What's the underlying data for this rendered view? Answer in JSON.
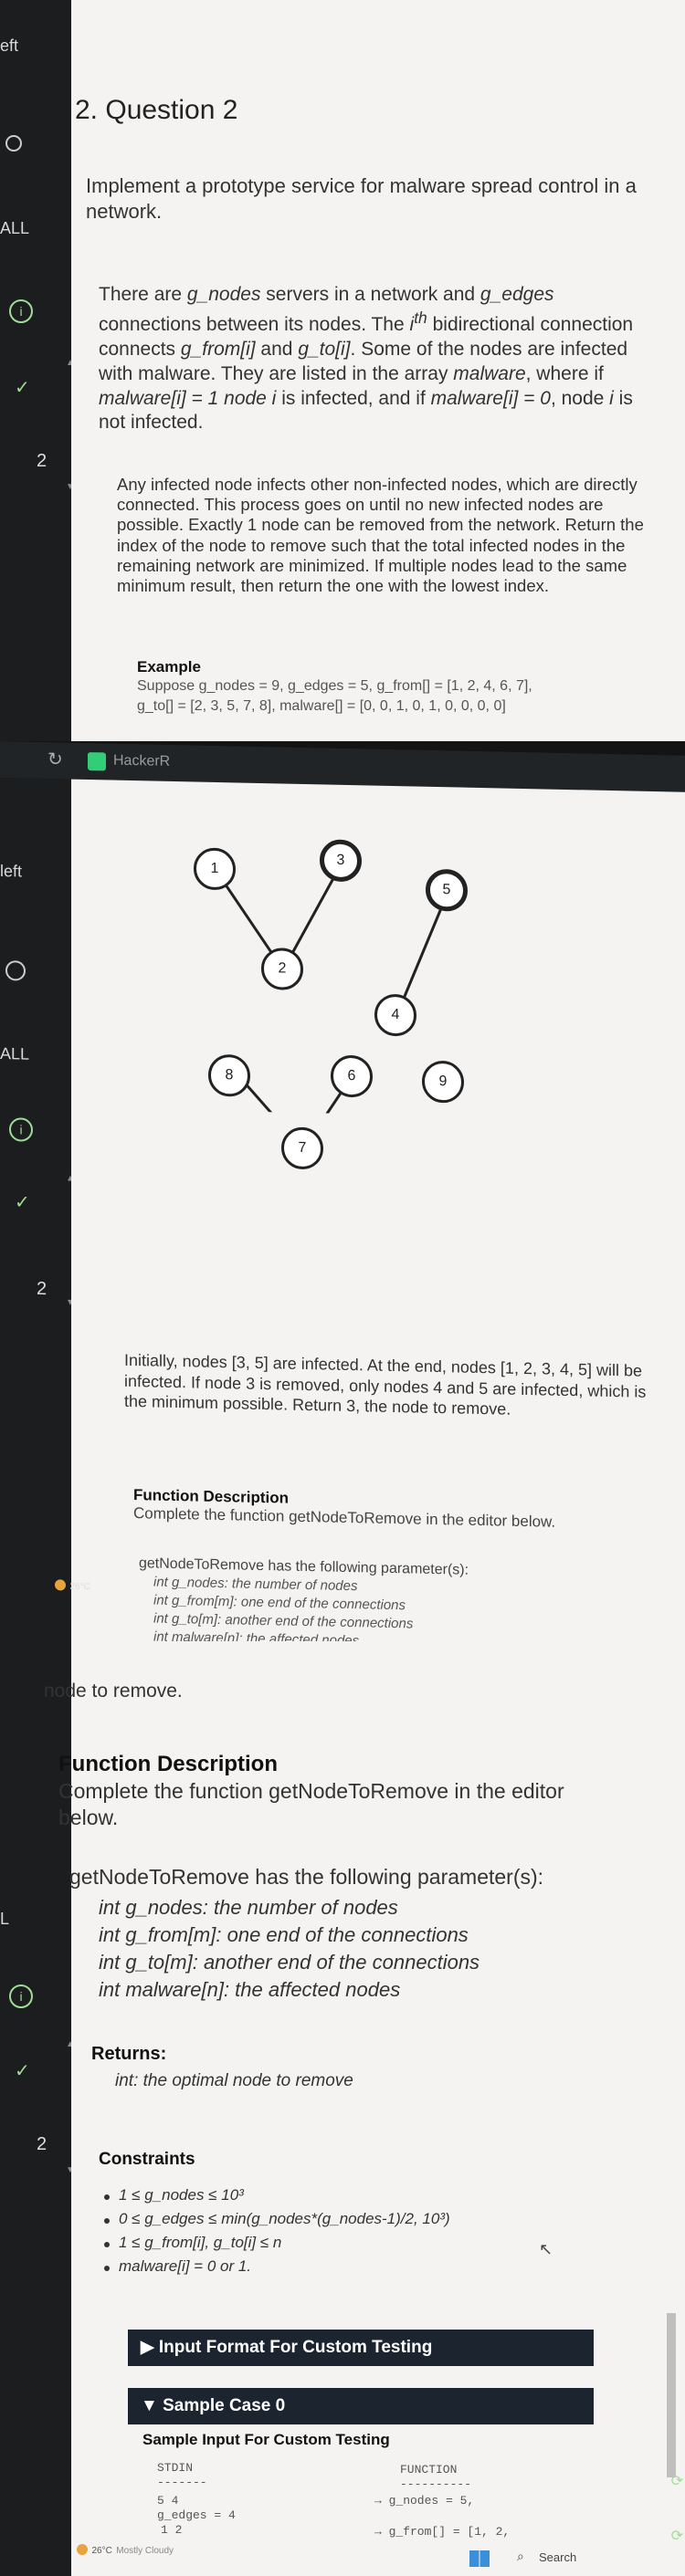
{
  "rail": {
    "label_left": "eft",
    "label_all": "ALL",
    "item_number": "2",
    "label_left2": "left",
    "label_all2": "ALL",
    "label_L": "L"
  },
  "question": {
    "title": "2. Question 2",
    "intro": "Implement a prototype service for malware spread control in a network.",
    "para1_a": "There are ",
    "para1_gnodes": "g_nodes",
    "para1_b": " servers in a network and ",
    "para1_gedges": "g_edges",
    "para1_c": " connections between its nodes. The ",
    "para1_ith": "i",
    "para1_th": "th",
    "para1_d": " bidirectional connection connects ",
    "para1_from": "g_from[i]",
    "para1_e": " and ",
    "para1_to": "g_to[i]",
    "para1_f": ". Some of the nodes are infected with malware. They are listed in the array ",
    "para1_malware": "malware",
    "para1_g": ", where if ",
    "para1_m1": "malware[i] = 1 node i",
    "para1_h": " is infected, and if ",
    "para1_m0": "malware[i] = 0",
    "para1_i": ", node ",
    "para1_ii": "i",
    "para1_j": " is not infected.",
    "para2": "Any infected node infects other non-infected nodes, which are directly connected. This process goes on until no new infected nodes are possible. Exactly 1 node can be removed from the network. Return the index of the node to remove such that the total infected nodes in the remaining network are minimized. If multiple nodes lead to the same minimum result, then return the one with the lowest index.",
    "example_heading": "Example",
    "example_line1": "Suppose g_nodes = 9, g_edges = 5, g_from[] = [1, 2, 4, 6, 7],",
    "example_line2": "g_to[] = [2, 3, 5, 7, 8], malware[] = [0, 0, 1, 0, 1, 0, 0, 0, 0]",
    "explanation": "Initially, nodes [3, 5] are infected. At the end, nodes [1, 2, 3, 4, 5] will be infected. If node 3 is removed, only nodes 4 and 5 are infected, which is the minimum possible. Return 3, the node to remove.",
    "fd_heading": "Function Description",
    "fd_text": "Complete the function getNodeToRemove in the editor below.",
    "params_heading": "getNodeToRemove has the following parameter(s):",
    "param1": "int g_nodes: the number of nodes",
    "param2": "int g_from[m]:  one end of the connections",
    "param3": "int g_to[m]:  another end of the connections",
    "param4": "int malware[n]:  the affected nodes",
    "tail_fragment": "node to remove.",
    "returns_heading": "Returns:",
    "returns_text": "int: the optimal node to remove",
    "constraints_heading": "Constraints",
    "c1": "1 ≤ g_nodes ≤ 10³",
    "c2": "0 ≤ g_edges ≤ min(g_nodes*(g_nodes-1)/2, 10³)",
    "c3": "1 ≤ g_from[i], g_to[i] ≤ n",
    "c4": "malware[i] = 0 or 1."
  },
  "graph": {
    "nodes": [
      "1",
      "2",
      "3",
      "4",
      "5",
      "6",
      "7",
      "8",
      "9"
    ],
    "infected": [
      "3",
      "5"
    ]
  },
  "custom": {
    "input_format": "▶ Input Format For Custom Testing",
    "sample_case": "▼ Sample Case 0",
    "sample_input_heading": "Sample Input For Custom Testing",
    "stdin_label": "STDIN",
    "stdin_rule": "-------",
    "function_label": "FUNCTION",
    "function_rule": "----------",
    "row1_stdin": "5 4",
    "row1_fn": "→  g_nodes = 5,",
    "row2_stdin": "g_edges = 4",
    "row3_stdin": "1 2",
    "row3_fn": "→  g_from[] = [1, 2,"
  },
  "browser": {
    "tab_text": "HackerR",
    "weather_temp": "26°C",
    "weather_desc": "Mostly Cloudy",
    "search_label": "Search"
  },
  "colors": {
    "accent_green": "#9fdc96",
    "dark_bar": "#1c2430",
    "page_bg": "#f4f3f1"
  }
}
